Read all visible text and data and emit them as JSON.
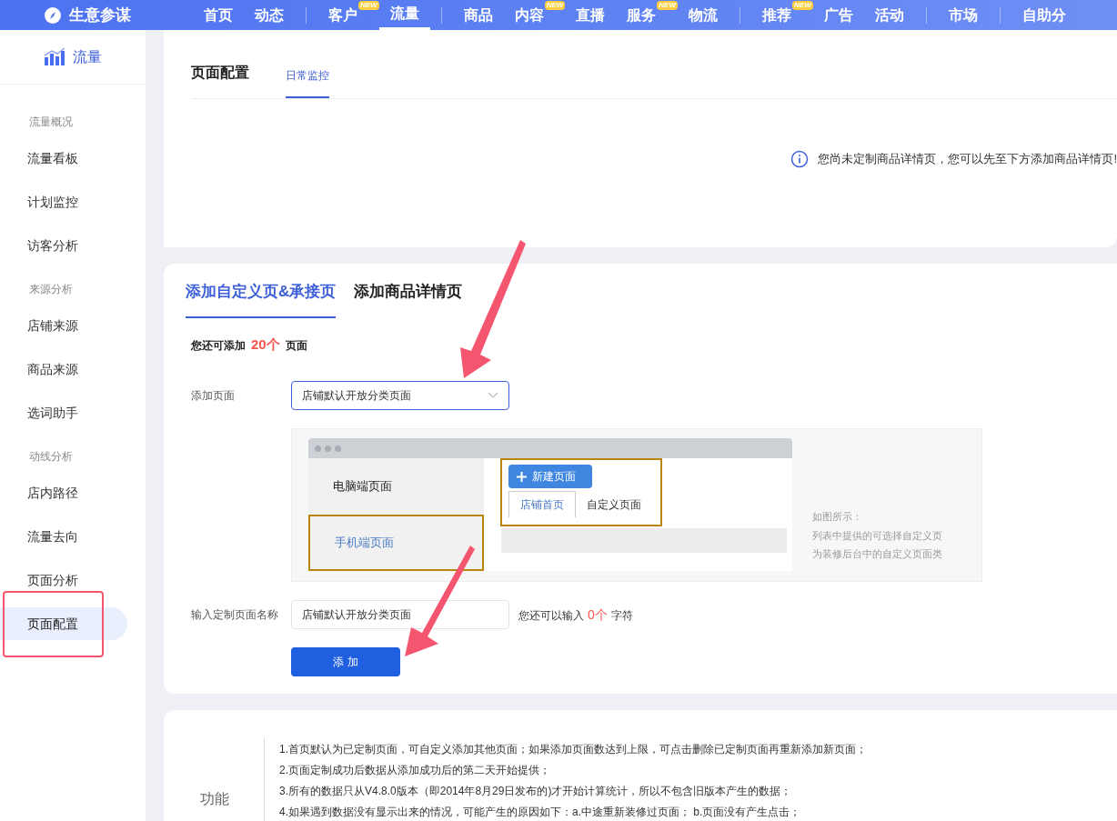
{
  "brand": "生意参谋",
  "nav": [
    {
      "label": "首页",
      "selected": false
    },
    {
      "label": "动态",
      "selected": false
    },
    {
      "label": "客户",
      "badge": "NEW",
      "selected": false,
      "divider_before": true
    },
    {
      "label": "流量",
      "selected": true
    },
    {
      "label": "商品",
      "selected": false,
      "divider_before": true
    },
    {
      "label": "内容",
      "badge": "NEW",
      "selected": false
    },
    {
      "label": "直播",
      "selected": false
    },
    {
      "label": "服务",
      "badge": "NEW",
      "selected": false
    },
    {
      "label": "物流",
      "selected": false
    },
    {
      "label": "推荐",
      "badge": "NEW",
      "selected": false,
      "divider_before": true
    },
    {
      "label": "广告",
      "selected": false
    },
    {
      "label": "活动",
      "selected": false
    },
    {
      "label": "市场",
      "selected": false,
      "divider_before": true
    },
    {
      "label": "自助分",
      "selected": false,
      "divider_before": true
    }
  ],
  "sidebar": {
    "title": "流量",
    "groups": [
      {
        "title": "流量概况",
        "items": [
          {
            "label": "流量看板",
            "selected": false
          },
          {
            "label": "计划监控",
            "selected": false
          },
          {
            "label": "访客分析",
            "selected": false
          }
        ]
      },
      {
        "title": "来源分析",
        "items": [
          {
            "label": "店铺来源",
            "selected": false
          },
          {
            "label": "商品来源",
            "selected": false
          },
          {
            "label": "选词助手",
            "selected": false
          }
        ]
      },
      {
        "title": "动线分析",
        "items": [
          {
            "label": "店内路径",
            "selected": false
          },
          {
            "label": "流量去向",
            "selected": false
          },
          {
            "label": "页面分析",
            "selected": false
          },
          {
            "label": "页面配置",
            "selected": true
          }
        ]
      }
    ]
  },
  "config_card": {
    "title": "页面配置",
    "tabs": [
      {
        "label": "日常监控",
        "selected": true
      }
    ],
    "notice": "您尚未定制商品详情页，您可以先至下方添加商品详情页!"
  },
  "add_card": {
    "tabs": [
      {
        "label": "添加自定义页&承接页",
        "selected": true
      },
      {
        "label": "添加商品详情页",
        "selected": false
      }
    ],
    "quota": {
      "prefix": "您还可添加",
      "count": "20个",
      "suffix": "页面"
    },
    "page_select": {
      "label": "添加页面",
      "value": "店铺默认开放分类页面"
    },
    "example": {
      "side_items": [
        {
          "label": "电脑端页面",
          "highlighted": false
        },
        {
          "label": "手机端页面",
          "highlighted": true
        }
      ],
      "new_button": "新建页面",
      "tabs": [
        {
          "label": "店铺首页",
          "selected": true
        },
        {
          "label": "自定义页面",
          "selected": false
        }
      ],
      "caption": [
        "如图所示：",
        "列表中提供的可选择自定义页",
        "为装修后台中的自定义页面类"
      ]
    },
    "name_input": {
      "label": "输入定制页面名称",
      "value": "店铺默认开放分类页面",
      "hint_prefix": "您还可以输入",
      "hint_count": "0个",
      "hint_suffix": "字符"
    },
    "submit": "添 加"
  },
  "notes_card": {
    "title": "功能",
    "items": [
      "1.首页默认为已定制页面，可自定义添加其他页面；如果添加页面数达到上限，可点击删除已定制页面再重新添加新页面；",
      "2.页面定制成功后数据从添加成功后的第二天开始提供；",
      "3.所有的数据只从V4.8.0版本（即2014年8月29日发布的)才开始计算统计，所以不包含旧版本产生的数据；",
      "4.如果遇到数据没有显示出来的情况，可能产生的原因如下：a.中途重新装修过页面； b.页面没有产生点击；"
    ]
  }
}
